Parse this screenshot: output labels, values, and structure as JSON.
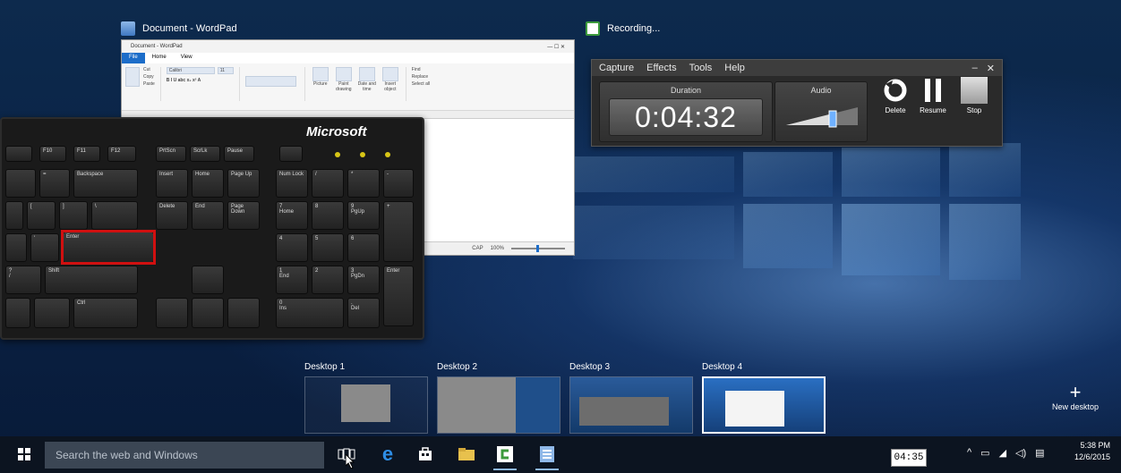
{
  "wordpad": {
    "title": "Document - WordPad",
    "titlebar_text": "Document - WordPad",
    "tabs": [
      "File",
      "Home",
      "View"
    ],
    "ribbon": {
      "clipboard_group": "Clipboard",
      "font_group": "Font",
      "paragraph_group": "Paragraph",
      "insert_group": "Insert",
      "editing_group": "Editing",
      "paste_label": "Paste",
      "cut_label": "Cut",
      "copy_label": "Copy",
      "font_name": "Calibri",
      "font_size": "11",
      "picture_label": "Picture",
      "paint_drawing_label": "Paint drawing",
      "date_time_label": "Date and time",
      "insert_object_label": "Insert object",
      "find_label": "Find",
      "replace_label": "Replace",
      "select_all_label": "Select all"
    },
    "status": {
      "caps": "CAP",
      "zoom": "100%"
    }
  },
  "keyboard": {
    "brand": "Microsoft",
    "keys": {
      "f10": "F10",
      "f11": "F11",
      "f12": "F12",
      "prtsc": "PrtScn",
      "scrlk": "ScrLk",
      "pause": "Pause",
      "backspace": "Backspace",
      "insert": "Insert",
      "home": "Home",
      "pgup": "Page Up",
      "delete": "Delete",
      "end": "End",
      "pgdn": "Page Down",
      "numlock": "Num Lock",
      "slash": "/",
      "star": "*",
      "minus": "-",
      "equals": "=",
      "lbracket": "[",
      "rbracket": "]",
      "backslash": "\\",
      "enter": "Enter",
      "quote": "'",
      "question": "?",
      "fslash": "/",
      "shift": "Shift",
      "ctrl": "Ctrl",
      "num7": "7",
      "num7sub": "Home",
      "num8": "8",
      "num9": "9",
      "num9sub": "PgUp",
      "plus": "+",
      "num4": "4",
      "num5": "5",
      "num6": "6",
      "num1": "1",
      "num1sub": "End",
      "num2": "2",
      "num3": "3",
      "num3sub": "PgDn",
      "numenter": "Enter",
      "num0": "0",
      "num0sub": "Ins",
      "numdot": ".",
      "numdotsub": "Del"
    }
  },
  "recorder": {
    "window_title": "Recording...",
    "menu": [
      "Capture",
      "Effects",
      "Tools",
      "Help"
    ],
    "duration_label": "Duration",
    "duration_value": "0:04:32",
    "audio_label": "Audio",
    "audio_level": 0.65,
    "buttons": {
      "delete": "Delete",
      "resume": "Resume",
      "stop": "Stop"
    }
  },
  "desktops": {
    "items": [
      {
        "label": "Desktop 1",
        "active": false
      },
      {
        "label": "Desktop 2",
        "active": false
      },
      {
        "label": "Desktop 3",
        "active": false
      },
      {
        "label": "Desktop 4",
        "active": true
      }
    ],
    "new_desktop_label": "New desktop"
  },
  "taskbar": {
    "search_placeholder": "Search the web and Windows",
    "time": "5:38 PM",
    "date": "12/6/2015",
    "timer_overlay": "04:35"
  },
  "colors": {
    "accent": "#1c6dc9",
    "highlight_box": "#d01010",
    "taskbar": "#0c1420"
  }
}
